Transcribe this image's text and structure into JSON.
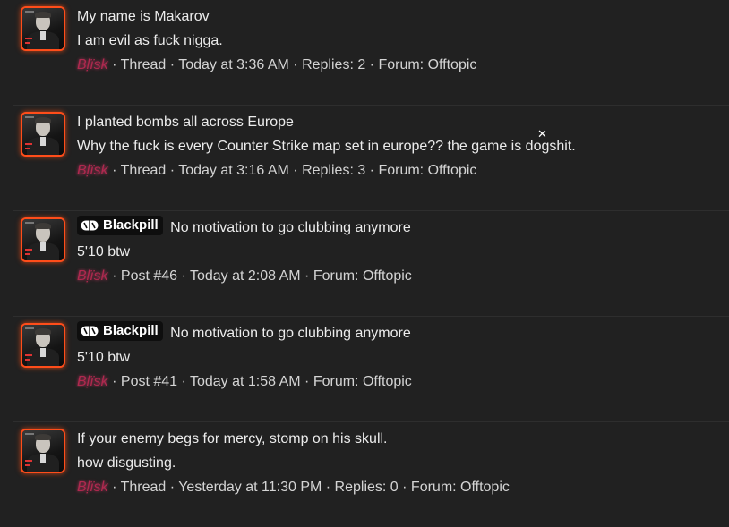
{
  "results": [
    {
      "title": "My name is Makarov",
      "snippet": "I am evil as fuck nigga.",
      "username": "Bḷïsk",
      "meta": " · Thread · Today at 3:36 AM · Replies: 2 · Forum: Offtopic"
    },
    {
      "title": "I planted bombs all across Europe",
      "snippet": "Why the fuck is every Counter Strike map set in europe?? the game is dogshit.",
      "username": "Bḷïsk",
      "meta": " · Thread · Today at 3:16 AM · Replies: 3 · Forum: Offtopic"
    },
    {
      "prefix": "Blackpill",
      "title": "No motivation to go clubbing anymore",
      "snippet": "5'10 btw",
      "username": "Bḷïsk",
      "meta": " · Post #46 · Today at 2:08 AM · Forum: Offtopic"
    },
    {
      "prefix": "Blackpill",
      "title": "No motivation to go clubbing anymore",
      "snippet": "5'10 btw",
      "username": "Bḷïsk",
      "meta": " · Post #41 · Today at 1:58 AM · Forum: Offtopic"
    },
    {
      "title": "If your enemy begs for mercy, stomp on his skull.",
      "snippet": "how disgusting.",
      "username": "Bḷïsk",
      "meta": " · Thread · Yesterday at 11:30 PM · Replies: 0 · Forum: Offtopic"
    }
  ],
  "cursor_glyph": "✕",
  "colors": {
    "background": "#212121",
    "avatar_glow": "#ff4d1a",
    "username": "#b0294f",
    "prefix_bg": "#0e0e0e"
  },
  "icons": {
    "prefix": "pill-icon",
    "cursor": "close-cursor-icon"
  }
}
